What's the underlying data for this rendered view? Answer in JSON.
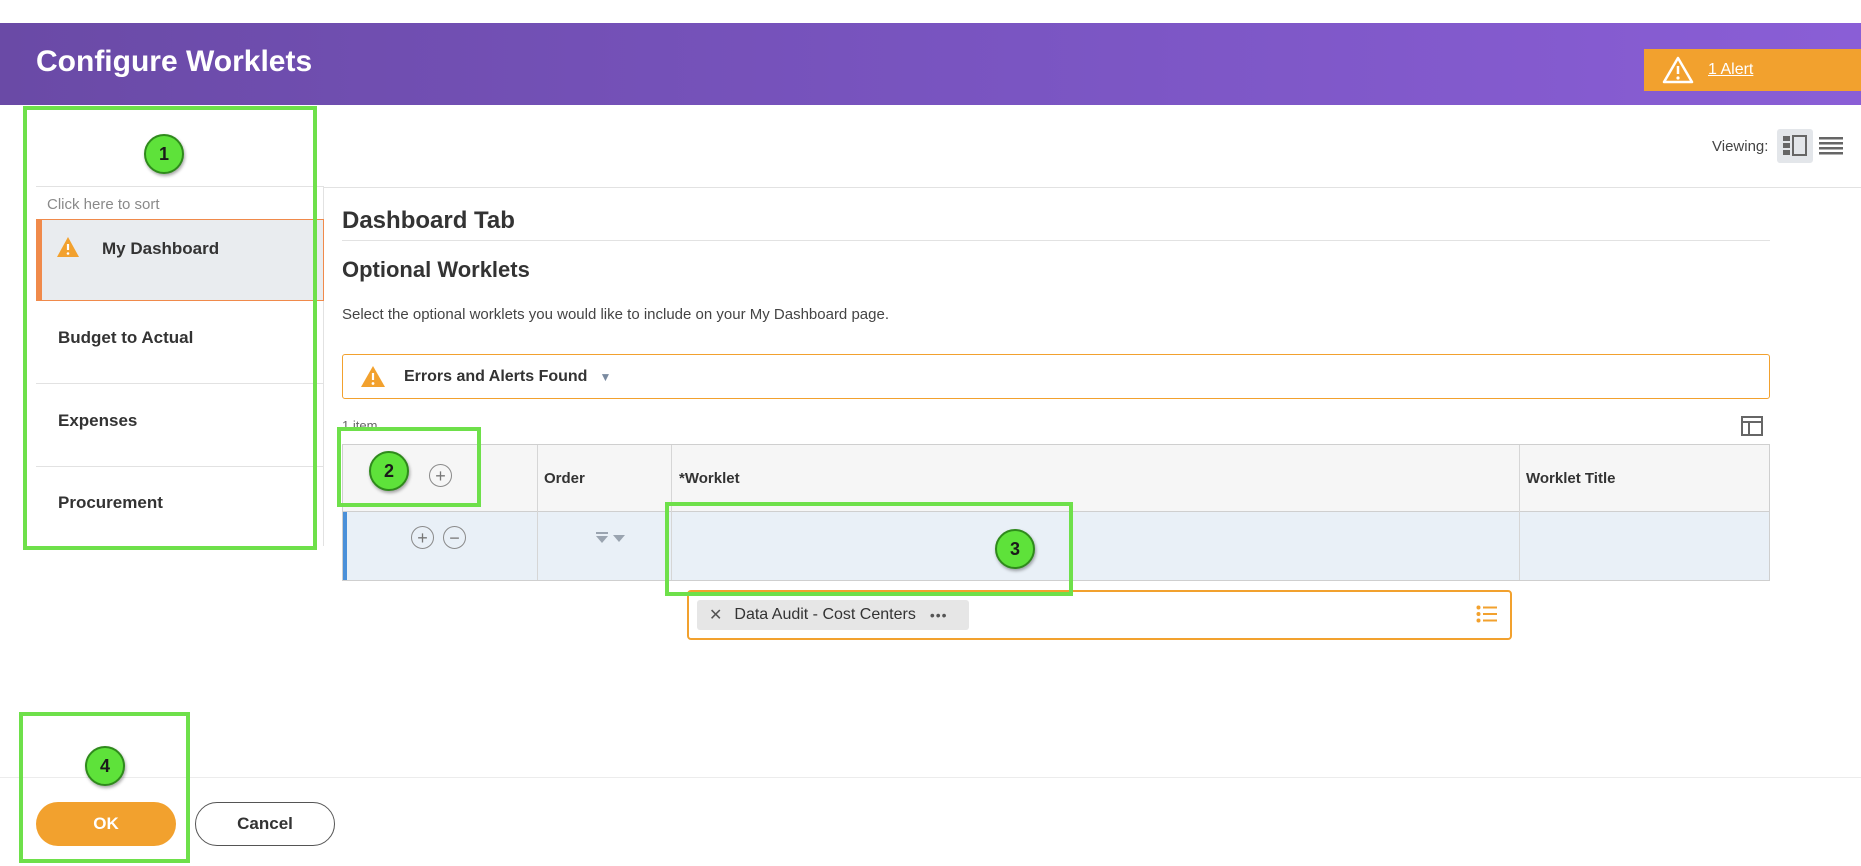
{
  "header": {
    "title": "Configure Worklets",
    "alert_label": "1 Alert",
    "alert_icon": "warning-icon"
  },
  "view_controls": {
    "label": "Viewing:",
    "icons": [
      "detail-view-icon",
      "list-view-icon"
    ]
  },
  "sidebar": {
    "sort_hint": "Click here to sort",
    "items": [
      {
        "label": "My Dashboard",
        "selected": true,
        "has_warning": true
      },
      {
        "label": "Budget to Actual"
      },
      {
        "label": "Expenses"
      },
      {
        "label": "Procurement"
      }
    ]
  },
  "main": {
    "section_title": "Dashboard Tab",
    "subsection_title": "Optional Worklets",
    "description": "Select the optional worklets you would like to include on your My Dashboard page.",
    "errors_label": "Errors and Alerts Found",
    "items_count": "1 item"
  },
  "grid": {
    "columns": [
      "",
      "Order",
      "*Worklet",
      "Worklet Title"
    ],
    "rows": [
      {
        "worklet": "Data Audit - Cost Centers",
        "title": ""
      }
    ]
  },
  "annotations": [
    "1",
    "2",
    "3",
    "4"
  ],
  "footer": {
    "ok_label": "OK",
    "cancel_label": "Cancel"
  },
  "colors": {
    "header_start": "#6a4aa6",
    "header_end": "#8a5ed6",
    "accent_orange": "#f2a12e",
    "selected_border": "#f08a4b",
    "annotation_green": "#6ee04a",
    "row_highlight": "#e9f0f7"
  }
}
